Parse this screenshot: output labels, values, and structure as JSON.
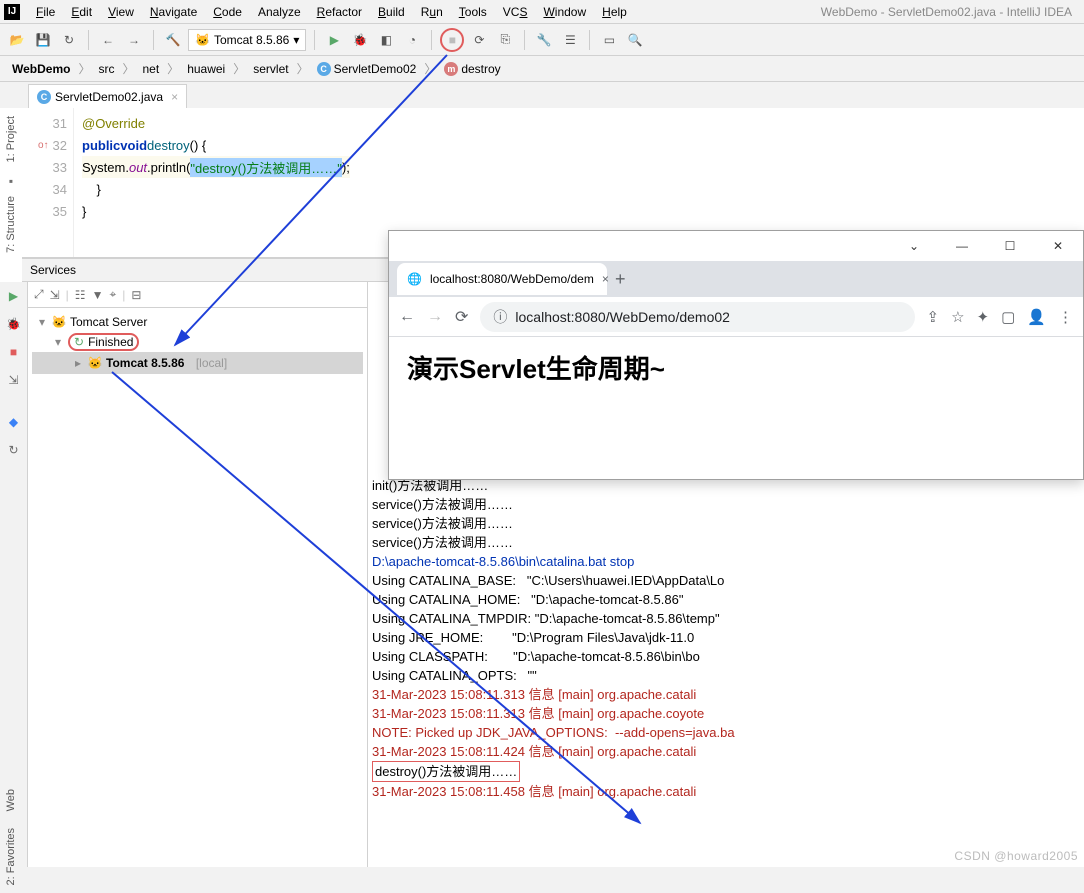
{
  "window_title": "WebDemo - ServletDemo02.java - IntelliJ IDEA",
  "menu": {
    "file": "File",
    "edit": "Edit",
    "view": "View",
    "navigate": "Navigate",
    "code": "Code",
    "analyze": "Analyze",
    "refactor": "Refactor",
    "build": "Build",
    "run": "Run",
    "tools": "Tools",
    "vcs": "VCS",
    "window": "Window",
    "help": "Help"
  },
  "run_config_label": "Tomcat 8.5.86",
  "breadcrumbs": {
    "root": "WebDemo",
    "p1": "src",
    "p2": "net",
    "p3": "huawei",
    "p4": "servlet",
    "p5": "ServletDemo02",
    "p6": "destroy"
  },
  "file_tab": "ServletDemo02.java",
  "left_tools": {
    "project": "1: Project",
    "structure": "7: Structure",
    "web": "Web",
    "favorites": "2: Favorites"
  },
  "code_lines": {
    "l31_no": "31",
    "l31": "@Override",
    "l32_no": "32",
    "l32_kw1": "public",
    "l32_kw2": "void",
    "l32_fn": "destroy",
    "l32_rest": "() {",
    "l33_no": "33",
    "l33_a": "System.",
    "l33_b": "out",
    "l33_c": ".println(",
    "l33_str": "\"destroy()方法被调用……\"",
    "l33_d": ");",
    "l34_no": "34",
    "l34": "    }",
    "l35_no": "35",
    "l35": "}"
  },
  "services_label": "Services",
  "tree": {
    "root": "Tomcat Server",
    "finished": "Finished",
    "instance": "Tomcat 8.5.86",
    "local": "[local]"
  },
  "console": {
    "c1": "init()方法被调用……",
    "c2": "service()方法被调用……",
    "c3": "service()方法被调用……",
    "c4": "service()方法被调用……",
    "c5": "D:\\apache-tomcat-8.5.86\\bin\\catalina.bat stop",
    "c6": "Using CATALINA_BASE:   \"C:\\Users\\huawei.IED\\AppData\\Lo",
    "c7": "Using CATALINA_HOME:   \"D:\\apache-tomcat-8.5.86\"",
    "c8": "Using CATALINA_TMPDIR: \"D:\\apache-tomcat-8.5.86\\temp\"",
    "c9": "Using JRE_HOME:        \"D:\\Program Files\\Java\\jdk-11.0",
    "c10": "Using CLASSPATH:       \"D:\\apache-tomcat-8.5.86\\bin\\bo",
    "c11": "Using CATALINA_OPTS:   \"\"",
    "c12": "31-Mar-2023 15:08:11.313 信息 [main] org.apache.catali",
    "c13": "31-Mar-2023 15:08:11.313 信息 [main] org.apache.coyote",
    "c14": "NOTE: Picked up JDK_JAVA_OPTIONS:  --add-opens=java.ba",
    "c15": "31-Mar-2023 15:08:11.424 信息 [main] org.apache.catali",
    "c16": "destroy()方法被调用……",
    "c17": "31-Mar-2023 15:08:11.458 信息 [main] org.apache.catali"
  },
  "browser": {
    "tab_title": "localhost:8080/WebDemo/dem",
    "url": "localhost:8080/WebDemo/demo02",
    "content": "演示Servlet生命周期~"
  },
  "watermark": "CSDN @howard2005"
}
